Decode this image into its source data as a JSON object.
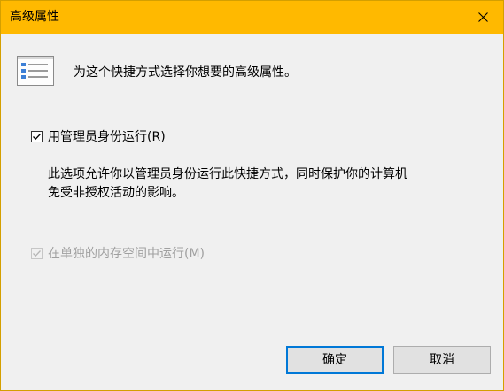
{
  "window": {
    "title": "高级属性"
  },
  "header": {
    "text": "为这个快捷方式选择你想要的高级属性。",
    "icon": "properties-list-icon"
  },
  "options": {
    "run_as_admin": {
      "label": "用管理员身份运行(R)",
      "checked": true,
      "enabled": true,
      "description_line1": "此选项允许你以管理员身份运行此快捷方式，同时保护你的计算机",
      "description_line2": "免受非授权活动的影响。"
    },
    "separate_memory": {
      "label": "在单独的内存空间中运行(M)",
      "checked": true,
      "enabled": false
    }
  },
  "buttons": {
    "ok_label": "确定",
    "cancel_label": "取消"
  },
  "colors": {
    "titlebar": "#ffb900",
    "accent": "#0078d7",
    "disabled_text": "#a0a0a0"
  }
}
